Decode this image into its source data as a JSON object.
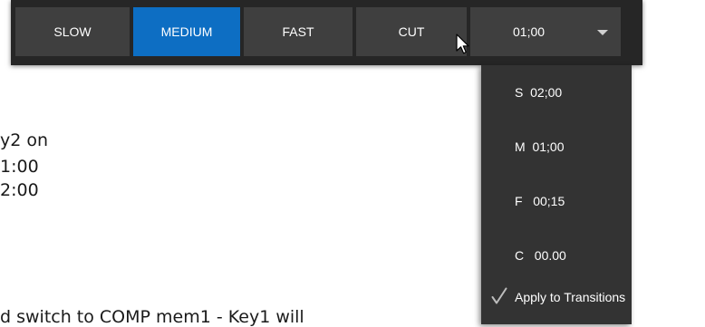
{
  "document": {
    "lines": [
      "y2 on",
      " 1:00",
      " 2:00",
      "d switch to COMP mem1 - Key1 will"
    ]
  },
  "toolbar": {
    "buttons": [
      {
        "label": "SLOW",
        "active": false
      },
      {
        "label": "MEDIUM",
        "active": true
      },
      {
        "label": "FAST",
        "active": false
      },
      {
        "label": "CUT",
        "active": false
      }
    ],
    "duration": {
      "value": "01;00",
      "icon": "chevron-down-icon"
    }
  },
  "menu": {
    "items": [
      {
        "label": "S  02;00"
      },
      {
        "label": "M  01;00"
      },
      {
        "label": "F   00;15"
      },
      {
        "label": "C   00.00"
      }
    ],
    "apply": {
      "label": "Apply to Transitions",
      "checked": true,
      "icon": "checkmark-icon"
    }
  },
  "colors": {
    "toolbar_bg": "#262626",
    "button_bg": "#3f3f3f",
    "active_accent": "#0d6ec3",
    "menu_bg": "#333333",
    "text_light": "#ffffff"
  }
}
